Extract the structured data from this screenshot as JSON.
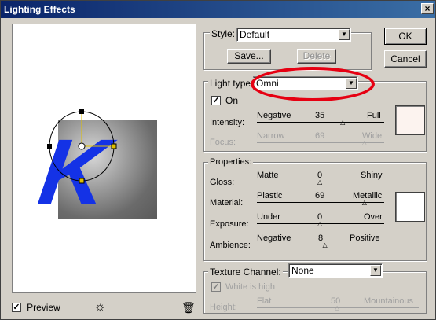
{
  "window": {
    "title": "Lighting Effects",
    "close_glyph": "×"
  },
  "preview": {
    "label": "Preview",
    "checked": "✓",
    "letter": "K",
    "bulb_glyph": "☼",
    "trash_glyph": "🗑"
  },
  "style": {
    "label": "Style:",
    "value": "Default",
    "save_label": "Save...",
    "delete_label": "Delete"
  },
  "buttons": {
    "ok": "OK",
    "cancel": "Cancel"
  },
  "light_type": {
    "label": "Light type:",
    "value": "Omni",
    "on_label": "On",
    "on_checked": "✓"
  },
  "intensity": {
    "label": "Intensity:",
    "left": "Negative",
    "value": "35",
    "right": "Full",
    "level_fraction": 0.68
  },
  "focus": {
    "label": "Focus:",
    "left": "Narrow",
    "value": "69",
    "right": "Wide",
    "level_fraction": 0.85
  },
  "properties": {
    "title": "Properties:"
  },
  "gloss": {
    "label": "Gloss:",
    "left": "Matte",
    "value": "0",
    "right": "Shiny",
    "level_fraction": 0.5
  },
  "material": {
    "label": "Material:",
    "left": "Plastic",
    "value": "69",
    "right": "Metallic",
    "level_fraction": 0.85
  },
  "exposure": {
    "label": "Exposure:",
    "left": "Under",
    "value": "0",
    "right": "Over",
    "level_fraction": 0.5
  },
  "ambience": {
    "label": "Ambience:",
    "left": "Negative",
    "value": "8",
    "right": "Positive",
    "level_fraction": 0.54
  },
  "texture": {
    "label": "Texture Channel:",
    "value": "None",
    "white_high_label": "White is high",
    "white_high_checked": "✓"
  },
  "height": {
    "label": "Height:",
    "left": "Flat",
    "value": "50",
    "right": "Mountainous",
    "level_fraction": 0.5
  },
  "colors": {
    "light_swatch": "#fcf3ef",
    "material_swatch": "#ffffff",
    "letter_blue": "#1432e6",
    "highlight_red": "#e60012"
  }
}
